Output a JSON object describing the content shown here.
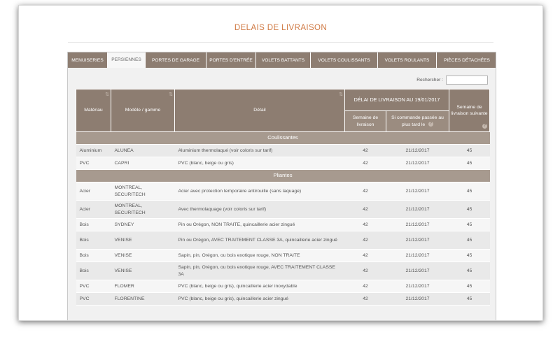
{
  "page": {
    "title": "DELAIS DE LIVRAISON"
  },
  "tabs": [
    {
      "label": "MENUISERIES",
      "active": false
    },
    {
      "label": "PERSIENNES",
      "active": true
    },
    {
      "label": "PORTES DE GARAGE",
      "active": false
    },
    {
      "label": "PORTES D'ENTRÉE",
      "active": false
    },
    {
      "label": "VOLETS BATTANTS",
      "active": false
    },
    {
      "label": "VOLETS COULISSANTS",
      "active": false
    },
    {
      "label": "VOLETS ROULANTS",
      "active": false
    },
    {
      "label": "PIÈCES DÉTACHÉES",
      "active": false
    }
  ],
  "search": {
    "label": "Rechercher :",
    "value": ""
  },
  "table": {
    "headers": {
      "material": "Matériau",
      "model": "Modèle / gamme",
      "detail": "Détail",
      "delay_group": "DÉLAI DE LIVRAISON AU 19/01/2017",
      "delivery_week": "Semaine de livraison",
      "order_by": "Si commande passée au plus tard le",
      "next_week": "Semaine de livraison suivante"
    },
    "groups": [
      {
        "name": "Coulissantes",
        "rows": [
          {
            "material": "Aluminium",
            "model": "ALUNEA",
            "detail": "Aluminium thermolaqué (voir coloris sur tarif)",
            "week": "42",
            "order_by": "21/12/2017",
            "next_week": "45"
          },
          {
            "material": "PVC",
            "model": "CAPRI",
            "detail": "PVC (blanc, beige ou gris)",
            "week": "42",
            "order_by": "21/12/2017",
            "next_week": "45"
          }
        ]
      },
      {
        "name": "Pliantes",
        "rows": [
          {
            "material": "Acier",
            "model": "MONTREAL, SECURITECH",
            "detail": "Acier avec protection temporaire antirouille (sans laquage)",
            "week": "42",
            "order_by": "21/12/2017",
            "next_week": "45"
          },
          {
            "material": "Acier",
            "model": "MONTREAL, SECURITECH",
            "detail": "Avec thermolaquage (voir coloris sur tarif)",
            "week": "42",
            "order_by": "21/12/2017",
            "next_week": "45"
          },
          {
            "material": "Bois",
            "model": "SYDNEY",
            "detail": "Pin ou Orégon, NON TRAITE, quincaillerie acier zingué",
            "week": "42",
            "order_by": "21/12/2017",
            "next_week": "45"
          },
          {
            "material": "Bois",
            "model": "VENISE",
            "detail": "Pin ou Orégon, AVEC TRAITEMENT CLASSE 3A, quincaillerie acier zingué",
            "week": "42",
            "order_by": "21/12/2017",
            "next_week": "45"
          },
          {
            "material": "Bois",
            "model": "VENISE",
            "detail": "Sapin, pin, Orégon, ou bois exotique rouge, NON TRAITE",
            "week": "42",
            "order_by": "21/12/2017",
            "next_week": "45"
          },
          {
            "material": "Bois",
            "model": "VENISE",
            "detail": "Sapin, pin, Orégon, ou bois exotique rouge, AVEC TRAITEMENT CLASSE 3A",
            "week": "42",
            "order_by": "21/12/2017",
            "next_week": "45"
          },
          {
            "material": "PVC",
            "model": "FLOMER",
            "detail": "PVC (blanc, beige ou gris), quincaillerie acier inoxydable",
            "week": "42",
            "order_by": "21/12/2017",
            "next_week": "45"
          },
          {
            "material": "PVC",
            "model": "FLORENTINE",
            "detail": "PVC (blanc, beige ou gris), quincaillerie acier zingué",
            "week": "42",
            "order_by": "21/12/2017",
            "next_week": "45"
          }
        ]
      }
    ]
  },
  "colors": {
    "accent": "#d07a44",
    "header_bg": "#8d7d71",
    "group_bg": "#a79a8f"
  }
}
